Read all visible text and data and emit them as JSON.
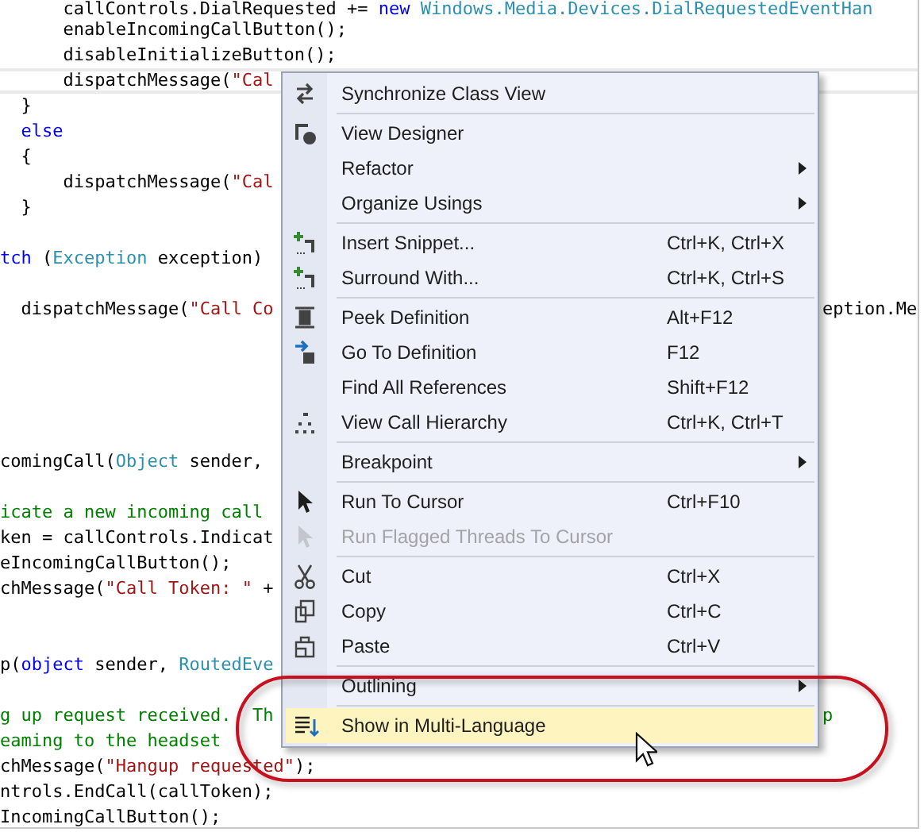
{
  "editor": {
    "lines": [
      {
        "current": false,
        "segments": [
          {
            "kind": "plain",
            "text": "      callControls.DialRequested += "
          },
          {
            "kind": "keyword",
            "text": "new"
          },
          {
            "kind": "type",
            "text": " Windows.Media.Devices.DialRequestedEventHan"
          }
        ]
      },
      {
        "current": false,
        "segments": [
          {
            "kind": "plain",
            "text": "      enableIncomingCallButton();"
          }
        ]
      },
      {
        "current": false,
        "segments": [
          {
            "kind": "plain",
            "text": "      disableInitializeButton();"
          }
        ]
      },
      {
        "current": true,
        "segments": [
          {
            "kind": "plain",
            "text": "      dispatchMessage("
          },
          {
            "kind": "string",
            "text": "\"Cal"
          }
        ]
      },
      {
        "current": false,
        "segments": [
          {
            "kind": "plain",
            "text": "  }"
          }
        ]
      },
      {
        "current": false,
        "segments": [
          {
            "kind": "keyword",
            "text": "  else"
          }
        ]
      },
      {
        "current": false,
        "segments": [
          {
            "kind": "plain",
            "text": "  {"
          }
        ]
      },
      {
        "current": false,
        "segments": [
          {
            "kind": "plain",
            "text": "      dispatchMessage("
          },
          {
            "kind": "string",
            "text": "\"Cal"
          }
        ]
      },
      {
        "current": false,
        "segments": [
          {
            "kind": "plain",
            "text": "  }"
          }
        ]
      },
      {
        "current": false
      },
      {
        "current": false,
        "segments": [
          {
            "kind": "keyword",
            "text": "tch"
          },
          {
            "kind": "plain",
            "text": " ("
          },
          {
            "kind": "type",
            "text": "Exception"
          },
          {
            "kind": "plain",
            "text": " exception)"
          }
        ]
      },
      {
        "current": false
      },
      {
        "current": false,
        "segments": [
          {
            "kind": "plain",
            "text": "  dispatchMessage("
          },
          {
            "kind": "string",
            "text": "\"Call Co"
          }
        ],
        "tail": [
          {
            "kind": "plain",
            "text": "eption.Me"
          }
        ]
      },
      {
        "current": false
      },
      {
        "current": false
      },
      {
        "current": false
      },
      {
        "current": false
      },
      {
        "current": false
      },
      {
        "current": false,
        "segments": [
          {
            "kind": "plain",
            "text": "comingCall("
          },
          {
            "kind": "type",
            "text": "Object"
          },
          {
            "kind": "plain",
            "text": " sender,"
          }
        ]
      },
      {
        "current": false
      },
      {
        "current": false,
        "segments": [
          {
            "kind": "comment",
            "text": "icate a new incoming call"
          }
        ]
      },
      {
        "current": false,
        "segments": [
          {
            "kind": "plain",
            "text": "ken = callControls.Indicat"
          }
        ]
      },
      {
        "current": false,
        "segments": [
          {
            "kind": "plain",
            "text": "eIncomingCallButton();"
          }
        ]
      },
      {
        "current": false,
        "segments": [
          {
            "kind": "plain",
            "text": "chMessage("
          },
          {
            "kind": "string",
            "text": "\"Call Token: \""
          },
          {
            "kind": "plain",
            "text": " +"
          }
        ]
      },
      {
        "current": false
      },
      {
        "current": false
      },
      {
        "current": false,
        "segments": [
          {
            "kind": "plain",
            "text": "p("
          },
          {
            "kind": "keyword",
            "text": "object"
          },
          {
            "kind": "plain",
            "text": " sender, "
          },
          {
            "kind": "type",
            "text": "RoutedEve"
          }
        ]
      },
      {
        "current": false
      },
      {
        "current": false,
        "segments": [
          {
            "kind": "comment",
            "text": "g up request received.  Th"
          }
        ],
        "tail": [
          {
            "kind": "comment",
            "text": "p"
          }
        ]
      },
      {
        "current": false,
        "segments": [
          {
            "kind": "comment",
            "text": "eaming to the headset"
          }
        ]
      },
      {
        "current": false,
        "segments": [
          {
            "kind": "plain",
            "text": "chMessage("
          },
          {
            "kind": "string",
            "text": "\"Hangup requested\""
          },
          {
            "kind": "plain",
            "text": ");"
          }
        ]
      },
      {
        "current": false,
        "segments": [
          {
            "kind": "plain",
            "text": "ntrols.EndCall(callToken);"
          }
        ]
      },
      {
        "current": false,
        "segments": [
          {
            "kind": "plain",
            "text": "IncomingCallButton();"
          }
        ]
      }
    ]
  },
  "context_menu": {
    "items": [
      {
        "kind": "item",
        "label": "Synchronize Class View",
        "submenu": false,
        "disabled": false,
        "selected": false
      },
      {
        "kind": "separator"
      },
      {
        "kind": "item",
        "label": "View Designer",
        "submenu": false,
        "disabled": false,
        "selected": false
      },
      {
        "kind": "item",
        "label": "Refactor",
        "submenu": true,
        "disabled": false,
        "selected": false
      },
      {
        "kind": "item",
        "label": "Organize Usings",
        "submenu": true,
        "disabled": false,
        "selected": false
      },
      {
        "kind": "separator"
      },
      {
        "kind": "item",
        "label": "Insert Snippet...",
        "shortcut": "Ctrl+K, Ctrl+X",
        "submenu": false,
        "disabled": false,
        "selected": false
      },
      {
        "kind": "item",
        "label": "Surround With...",
        "shortcut": "Ctrl+K, Ctrl+S",
        "submenu": false,
        "disabled": false,
        "selected": false
      },
      {
        "kind": "separator"
      },
      {
        "kind": "item",
        "label": "Peek Definition",
        "shortcut": "Alt+F12",
        "submenu": false,
        "disabled": false,
        "selected": false
      },
      {
        "kind": "item",
        "label": "Go To Definition",
        "shortcut": "F12",
        "submenu": false,
        "disabled": false,
        "selected": false
      },
      {
        "kind": "item",
        "label": "Find All References",
        "shortcut": "Shift+F12",
        "submenu": false,
        "disabled": false,
        "selected": false
      },
      {
        "kind": "item",
        "label": "View Call Hierarchy",
        "shortcut": "Ctrl+K, Ctrl+T",
        "submenu": false,
        "disabled": false,
        "selected": false
      },
      {
        "kind": "separator"
      },
      {
        "kind": "item",
        "label": "Breakpoint",
        "submenu": true,
        "disabled": false,
        "selected": false
      },
      {
        "kind": "separator"
      },
      {
        "kind": "item",
        "label": "Run To Cursor",
        "shortcut": "Ctrl+F10",
        "submenu": false,
        "disabled": false,
        "selected": false
      },
      {
        "kind": "item",
        "label": "Run Flagged Threads To Cursor",
        "submenu": false,
        "disabled": true,
        "selected": false
      },
      {
        "kind": "separator"
      },
      {
        "kind": "item",
        "label": "Cut",
        "shortcut": "Ctrl+X",
        "submenu": false,
        "disabled": false,
        "selected": false
      },
      {
        "kind": "item",
        "label": "Copy",
        "shortcut": "Ctrl+C",
        "submenu": false,
        "disabled": false,
        "selected": false
      },
      {
        "kind": "item",
        "label": "Paste",
        "shortcut": "Ctrl+V",
        "submenu": false,
        "disabled": false,
        "selected": false
      },
      {
        "kind": "separator"
      },
      {
        "kind": "item",
        "label": "Outlining",
        "submenu": true,
        "disabled": false,
        "selected": false
      },
      {
        "kind": "separator"
      },
      {
        "kind": "item",
        "label": "Show in Multi-Language",
        "submenu": false,
        "disabled": false,
        "selected": true
      }
    ]
  },
  "annotations": [
    {
      "kind": "ellipse",
      "color": "#c8101e"
    }
  ]
}
